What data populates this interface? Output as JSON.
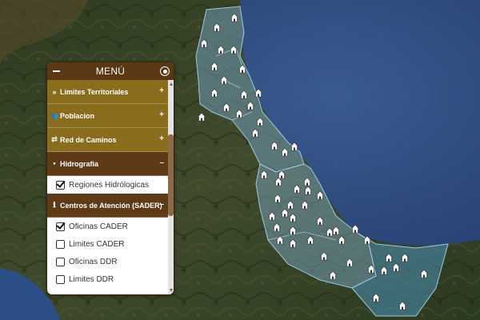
{
  "menu": {
    "title": "MENÚ",
    "sections": [
      {
        "label": "Limites Territoriales",
        "icon": "double-chevron-right-icon",
        "toggle": "+",
        "style": "olive",
        "options": []
      },
      {
        "label": "Poblacion",
        "icon": "users-icon",
        "toggle": "+",
        "style": "olive",
        "options": []
      },
      {
        "label": "Red de Caminos",
        "icon": "exchange-arrows-icon",
        "toggle": "+",
        "style": "olive",
        "options": []
      },
      {
        "label": "Hidrografia",
        "icon": "water-drop-icon",
        "toggle": "–",
        "style": "brown",
        "options": [
          {
            "label": "Regiones Hidrólogicas",
            "checked": true
          }
        ]
      },
      {
        "label": "Centros de Atención (SADER)",
        "icon": "info-icon",
        "toggle": "–",
        "style": "brown",
        "options": [
          {
            "label": "Oficinas CADER",
            "checked": true
          },
          {
            "label": "Limites CADER",
            "checked": false
          },
          {
            "label": "Oficinas DDR",
            "checked": false
          },
          {
            "label": "Limites DDR",
            "checked": false
          }
        ]
      }
    ]
  },
  "map": {
    "colors": {
      "land_dark": "#27331b",
      "land_mid": "#3d4a2a",
      "ocean": "#2d4a7a",
      "ocean_deep": "#24406e",
      "region_fill": "#6f9ab8",
      "region_fill_south": "#4d8fb8",
      "marker": "#ffffff"
    },
    "marker_icon": "house-marker-icon",
    "marker_count": 66
  }
}
